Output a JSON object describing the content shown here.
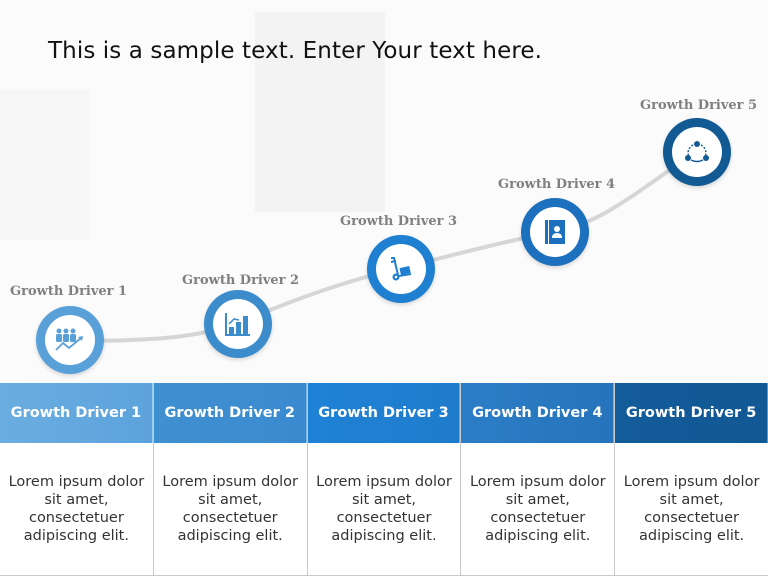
{
  "title": "This is a sample text. Enter Your text here.",
  "drivers": [
    {
      "label": "Growth Driver 1",
      "header": "Growth Driver  1",
      "icon": "team-growth-icon",
      "ring_color": "#5aa0d8",
      "header_color": "#6aaee0",
      "body": "Lorem ipsum dolor sit amet, consectetuer adipiscing elit."
    },
    {
      "label": "Growth Driver 2",
      "header": "Growth Driver 2",
      "icon": "bar-chart-icon",
      "ring_color": "#3c8ccc",
      "header_color": "#3d8fd0",
      "body": "Lorem ipsum dolor sit amet, consectetuer adipiscing elit."
    },
    {
      "label": "Growth Driver 3",
      "header": "Growth Driver 3",
      "icon": "hand-truck-icon",
      "ring_color": "#1f7fd0",
      "header_color": "#1f80d4",
      "body": "Lorem ipsum dolor sit amet, consectetuer adipiscing elit."
    },
    {
      "label": "Growth Driver 4",
      "header": "Growth Driver 4",
      "icon": "contact-book-icon",
      "ring_color": "#1d70bd",
      "header_color": "#2a7cc4",
      "body": "Lorem ipsum dolor sit amet, consectetuer adipiscing elit."
    },
    {
      "label": "Growth Driver 5",
      "header": "Growth Driver 5",
      "icon": "share-network-icon",
      "ring_color": "#125a94",
      "header_color": "#125b98",
      "body": "Lorem ipsum dolor sit amet, consectetuer adipiscing elit."
    }
  ]
}
